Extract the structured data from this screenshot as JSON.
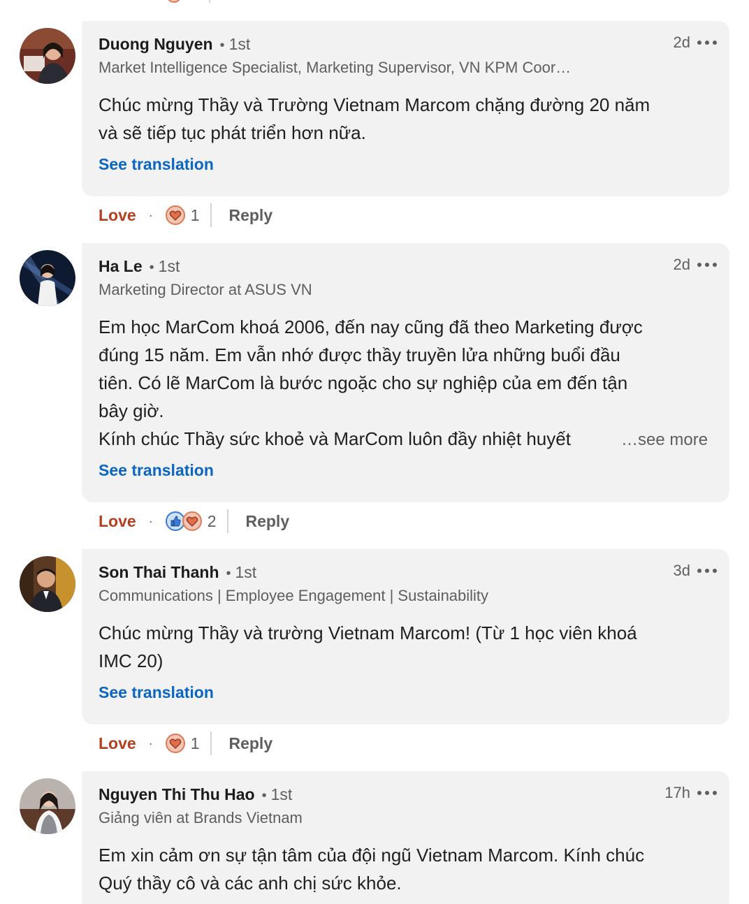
{
  "comments": [
    {
      "author": "Duong Nguyen",
      "degree": "1st",
      "headline": "Market Intelligence Specialist, Marketing Supervisor, VN KPM Coor…",
      "time": "2d",
      "text_lines": [
        "Chúc mừng Thầy và Trường Vietnam Marcom chặng đường 20 năm",
        "và sẽ tiếp tục phát triển hơn nữa."
      ],
      "see_translation": "See translation",
      "love_label": "Love",
      "reactions": [
        "love-icon"
      ],
      "reaction_count": "1",
      "reply_label": "Reply"
    },
    {
      "author": "Ha Le",
      "degree": "1st",
      "headline": "Marketing Director at ASUS VN",
      "time": "2d",
      "text_lines": [
        "Em học MarCom khoá 2006, đến nay cũng đã theo Marketing được",
        "đúng 15 năm. Em vẫn nhớ được thầy truyền lửa những buổi đầu",
        "tiên. Có lẽ MarCom là bước ngoặc cho sự nghiệp của em đến tận",
        "bây giờ."
      ],
      "truncated_line": "Kính chúc Thầy sức khoẻ và MarCom luôn đầy nhiệt huyết",
      "see_more": "…see more",
      "see_translation": "See translation",
      "love_label": "Love",
      "reactions": [
        "like-icon",
        "love-icon"
      ],
      "reaction_count": "2",
      "reply_label": "Reply"
    },
    {
      "author": "Son Thai Thanh",
      "degree": "1st",
      "headline": "Communications | Employee Engagement | Sustainability",
      "time": "3d",
      "text_lines": [
        "Chúc mừng Thầy và trường Vietnam Marcom! (Từ 1 học viên khoá",
        "IMC 20)"
      ],
      "see_translation": "See translation",
      "love_label": "Love",
      "reactions": [
        "love-icon"
      ],
      "reaction_count": "1",
      "reply_label": "Reply"
    },
    {
      "author": "Nguyen Thi Thu Hao",
      "degree": "1st",
      "headline": "Giảng viên at Brands Vietnam",
      "time": "17h",
      "text_lines": [
        "Em xin cảm ơn sự tận tâm của đội ngũ Vietnam Marcom. Kính chúc",
        "Quý thầy cô và các anh chị sức khỏe."
      ]
    }
  ],
  "colors": {
    "bubble": "#f2f2f2",
    "link_blue": "#0a66c2",
    "love_red": "#b24020",
    "secondary_text": "#5e5e5e"
  }
}
